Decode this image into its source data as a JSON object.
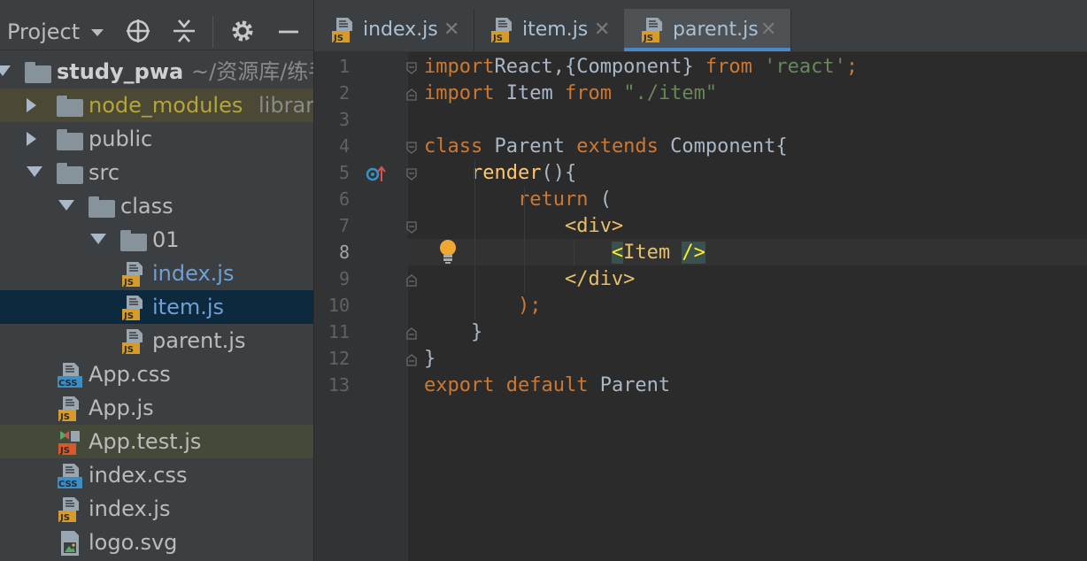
{
  "project_panel": {
    "title": "Project",
    "tree": [
      {
        "label": "study_pwa",
        "hint": "~/资源库/练手/s",
        "icon": "folder",
        "arrow": "down",
        "level": 0
      },
      {
        "label": "node_modules",
        "hint": "library ro",
        "icon": "folder",
        "arrow": "right",
        "level": 1,
        "style": "node"
      },
      {
        "label": "public",
        "icon": "folder",
        "arrow": "right",
        "level": 1
      },
      {
        "label": "src",
        "icon": "folder",
        "arrow": "down",
        "level": 1
      },
      {
        "label": "class",
        "icon": "folder",
        "arrow": "down",
        "level": 2
      },
      {
        "label": "01",
        "icon": "folder",
        "arrow": "down",
        "level": 3
      },
      {
        "label": "index.js",
        "icon": "js",
        "level": 4,
        "style": "blue"
      },
      {
        "label": "item.js",
        "icon": "js",
        "level": 4,
        "style": "blue",
        "selected": true
      },
      {
        "label": "parent.js",
        "icon": "js",
        "level": 4
      },
      {
        "label": "App.css",
        "icon": "css",
        "level": 2
      },
      {
        "label": "App.js",
        "icon": "js",
        "level": 2
      },
      {
        "label": "App.test.js",
        "icon": "test",
        "level": 2,
        "highlight": true
      },
      {
        "label": "index.css",
        "icon": "css",
        "level": 2
      },
      {
        "label": "index.js",
        "icon": "js",
        "level": 2
      },
      {
        "label": "logo.svg",
        "icon": "svg",
        "level": 2
      }
    ]
  },
  "tabs": [
    {
      "label": "index.js",
      "active": false
    },
    {
      "label": "item.js",
      "active": false
    },
    {
      "label": "parent.js",
      "active": true
    }
  ],
  "editor": {
    "current_line": 8,
    "line_numbers": [
      "1",
      "2",
      "3",
      "4",
      "5",
      "6",
      "7",
      "8",
      "9",
      "10",
      "11",
      "12",
      "13"
    ],
    "lines": [
      [
        [
          "kw",
          "import"
        ],
        [
          "",
          "React,{Component} "
        ],
        [
          "kw",
          "from"
        ],
        [
          "",
          " "
        ],
        [
          "str",
          "'react'"
        ],
        [
          "kw",
          ";"
        ]
      ],
      [
        [
          "kw",
          "import"
        ],
        [
          "",
          " Item "
        ],
        [
          "kw",
          "from"
        ],
        [
          "",
          " "
        ],
        [
          "str",
          "\"./item\""
        ]
      ],
      [],
      [
        [
          "kw",
          "class"
        ],
        [
          "",
          " Parent "
        ],
        [
          "kw",
          "extends"
        ],
        [
          "",
          " Component{"
        ]
      ],
      [
        [
          "",
          "    "
        ],
        [
          "fn",
          "render"
        ],
        [
          "",
          "(){"
        ]
      ],
      [
        [
          "",
          "        "
        ],
        [
          "kw",
          "return"
        ],
        [
          "",
          " ("
        ]
      ],
      [
        [
          "",
          "            "
        ],
        [
          "tag",
          "<div>"
        ]
      ],
      [
        [
          "",
          "                "
        ],
        [
          "tagm",
          "<"
        ],
        [
          "tag",
          "Item "
        ],
        [
          "tagm",
          "/>"
        ]
      ],
      [
        [
          "",
          "            "
        ],
        [
          "tag",
          "</div>"
        ]
      ],
      [
        [
          "",
          "        "
        ],
        [
          "kw",
          ");"
        ]
      ],
      [
        [
          "",
          "    }"
        ]
      ],
      [
        [
          "",
          "}"
        ]
      ],
      [
        [
          "kw",
          "export"
        ],
        [
          "",
          " "
        ],
        [
          "kw",
          "default"
        ],
        [
          "",
          " Parent"
        ]
      ]
    ]
  },
  "colors": {
    "accent": "#4a88c7",
    "selection": "#0d293e",
    "keyword": "#cc7832",
    "string": "#6a8759"
  }
}
